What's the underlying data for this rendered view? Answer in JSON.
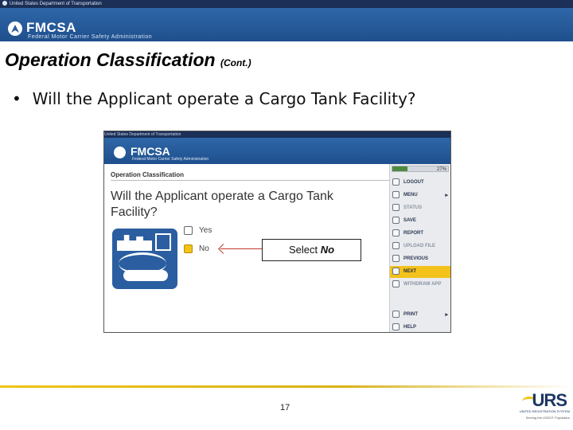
{
  "header": {
    "dot_text": "United States Department of Transportation",
    "brand": "FMCSA",
    "brand_sub": "Federal Motor Carrier Safety Administration"
  },
  "slide": {
    "title": "Operation Classification",
    "title_suffix": "(Cont.)",
    "bullet_marker": "•",
    "bullet_text": "Will the Applicant operate a Cargo Tank Facility?"
  },
  "screenshot": {
    "dot_text": "United States Department of Transportation",
    "brand": "FMCSA",
    "brand_sub": "Federal Motor Carrier Safety Administration",
    "pane_title": "Operation Classification",
    "question": "Will the Applicant operate a Cargo Tank Facility?",
    "options": [
      {
        "label": "Yes",
        "selected": false
      },
      {
        "label": "No",
        "selected": true
      }
    ],
    "callout_prefix": "Select ",
    "callout_emph": "No",
    "progress_text": "27%",
    "progress_value": 0.27,
    "menu": [
      {
        "label": "LOGOUT",
        "icon": "logout-icon"
      },
      {
        "label": "MENU",
        "icon": "menu-icon",
        "chevron": "▸"
      },
      {
        "label": "STATUS",
        "icon": "status-icon",
        "dim": true
      },
      {
        "label": "SAVE",
        "icon": "save-icon"
      },
      {
        "label": "REPORT",
        "icon": "report-icon"
      },
      {
        "label": "UPLOAD FILE",
        "icon": "upload-icon",
        "dim": true
      },
      {
        "label": "PREVIOUS",
        "icon": "previous-icon"
      },
      {
        "label": "NEXT",
        "icon": "next-icon",
        "active": true
      },
      {
        "label": "WITHDRAW APP",
        "icon": "withdraw-icon",
        "dim": true
      },
      {
        "label": "PRINT",
        "icon": "print-icon",
        "chevron": "▸"
      },
      {
        "label": "HELP",
        "icon": "help-icon"
      }
    ]
  },
  "footer": {
    "page_number": "17",
    "urs_logo": "URS",
    "urs_line1": "UNITED REGISTRATION SYSTEM",
    "urs_line2": "Serving the USDOT Population"
  },
  "colors": {
    "banner": "#2e67a8",
    "accent_yellow": "#f3c21b",
    "navy": "#1b2f57"
  }
}
